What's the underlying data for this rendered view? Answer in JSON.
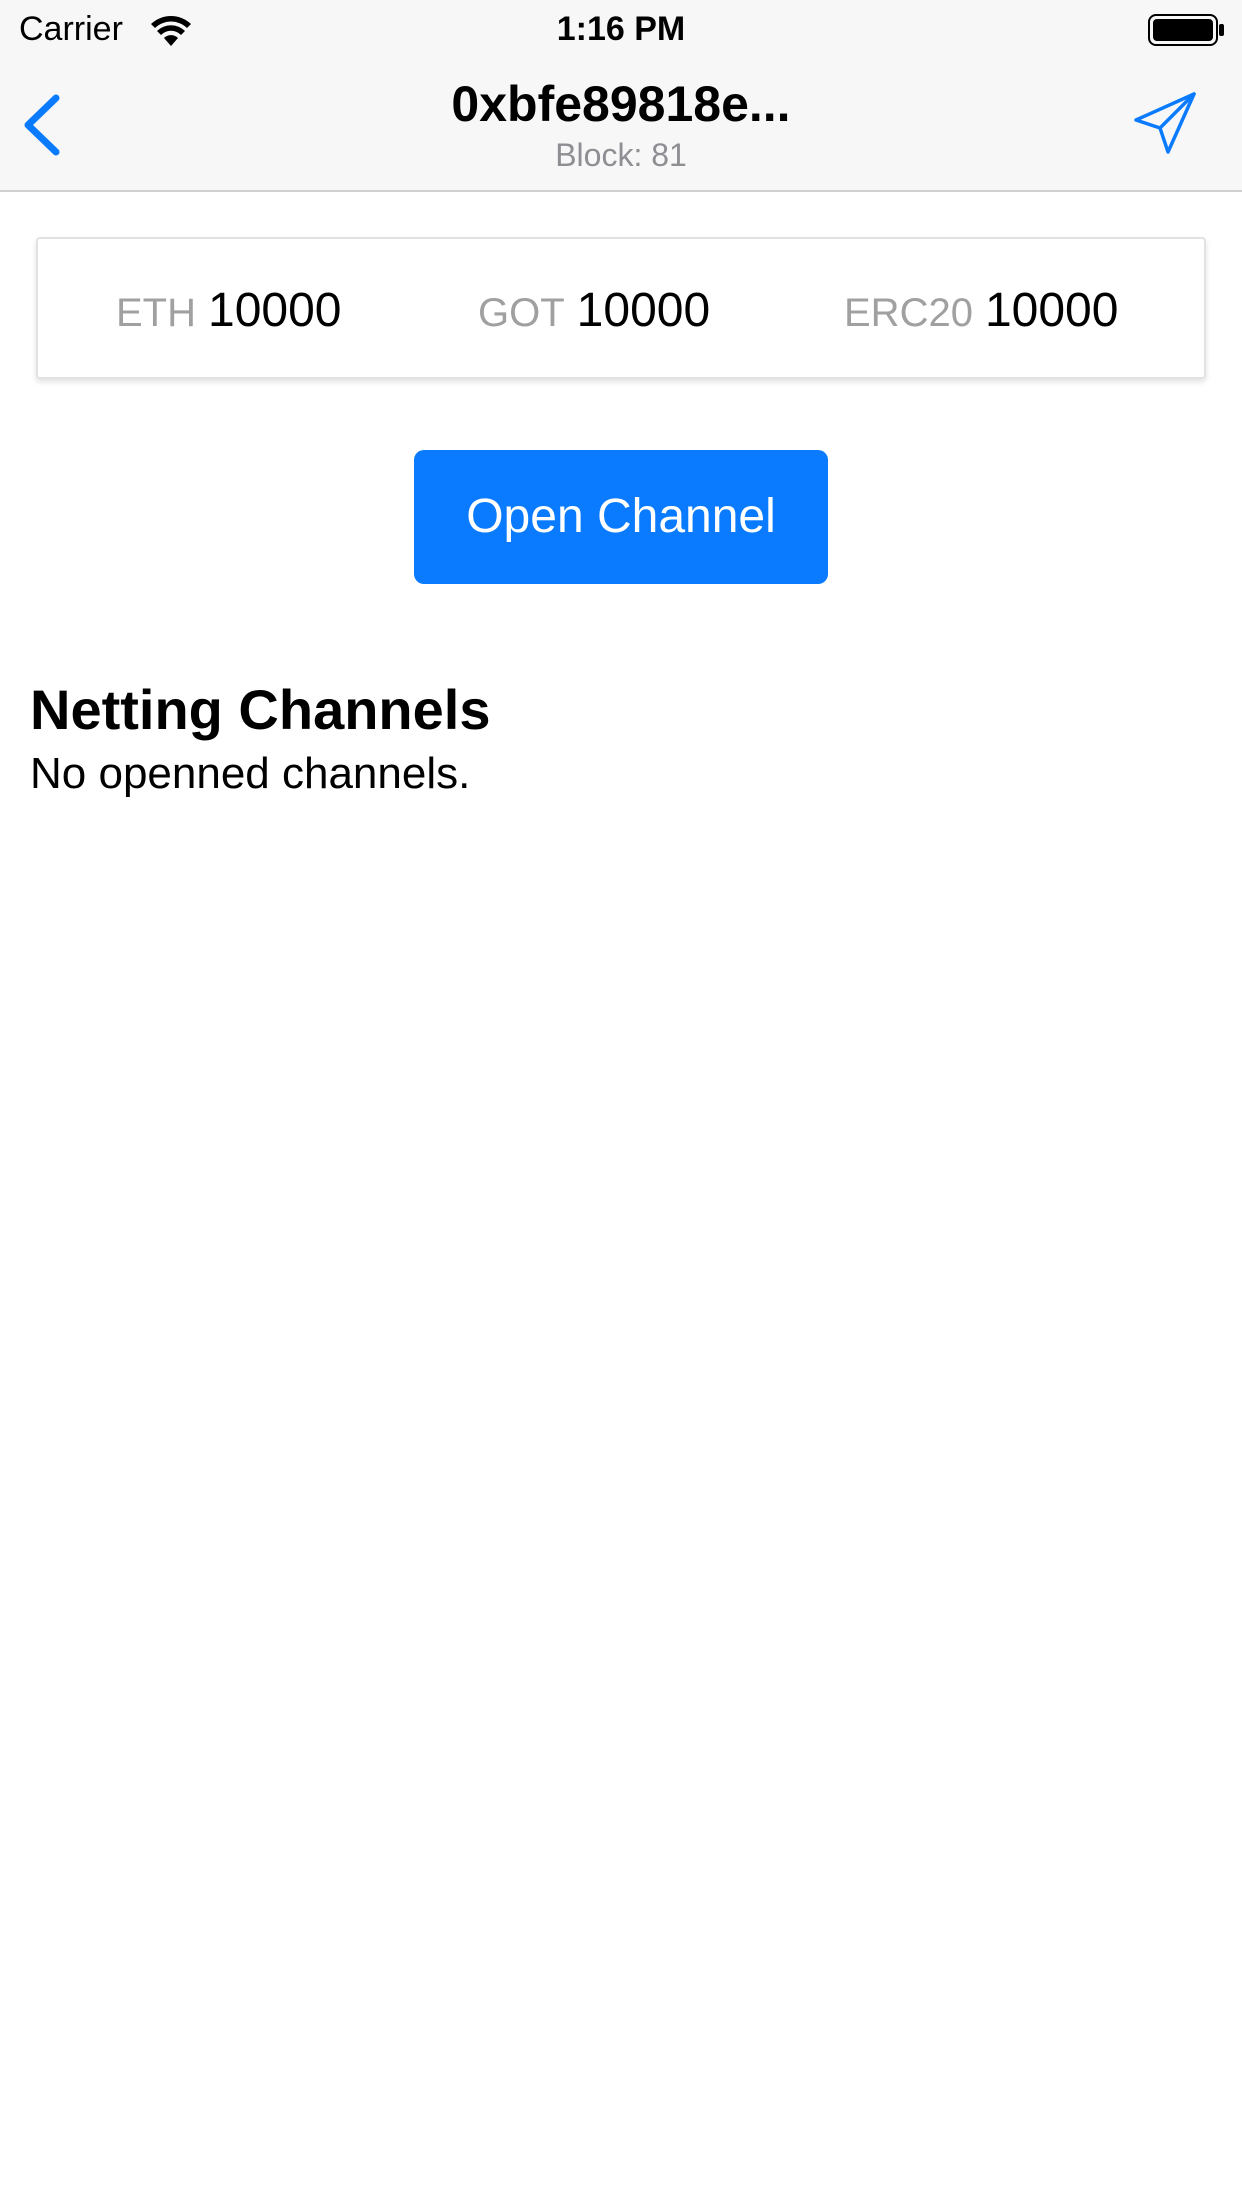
{
  "status_bar": {
    "carrier": "Carrier",
    "time": "1:16 PM"
  },
  "nav": {
    "title": "0xbfe89818e...",
    "subtitle": "Block: 81",
    "back_icon": "chevron-left-icon",
    "send_icon": "paper-plane-icon",
    "accent_color": "#0a7bff"
  },
  "balances": [
    {
      "symbol": "ETH",
      "value": "10000"
    },
    {
      "symbol": "GOT",
      "value": "10000"
    },
    {
      "symbol": "ERC20",
      "value": "10000"
    }
  ],
  "open_channel_label": "Open Channel",
  "channels": {
    "title": "Netting Channels",
    "empty_text": "No openned channels."
  }
}
